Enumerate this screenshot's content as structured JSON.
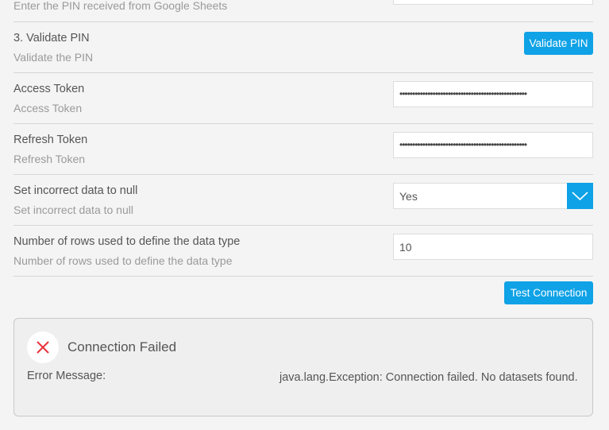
{
  "rows": [
    {
      "subtitle": "Enter the PIN received from Google Sheets"
    },
    {
      "title": "3. Validate PIN",
      "subtitle": "Validate the PIN",
      "button": "Validate PIN"
    },
    {
      "title": "Access Token",
      "subtitle": "Access Token",
      "value": "••••••••••••••••••••••••••••••••••••••••••••••••••"
    },
    {
      "title": "Refresh Token",
      "subtitle": "Refresh Token",
      "value": "••••••••••••••••••••••••••••••••••••••••••••••••••"
    },
    {
      "title": "Set incorrect data to null",
      "subtitle": "Set incorrect data to null",
      "value": "Yes"
    },
    {
      "title": "Number of rows used to define the data type",
      "subtitle": "Number of rows used to define the data type",
      "value": "10"
    }
  ],
  "test_button": "Test Connection",
  "error": {
    "title": "Connection Failed",
    "label": "Error Message:",
    "message": "java.lang.Exception: Connection failed. No datasets found.",
    "icon": "close-icon",
    "icon_color": "#e8323c"
  },
  "accent": "#0fa2e6"
}
